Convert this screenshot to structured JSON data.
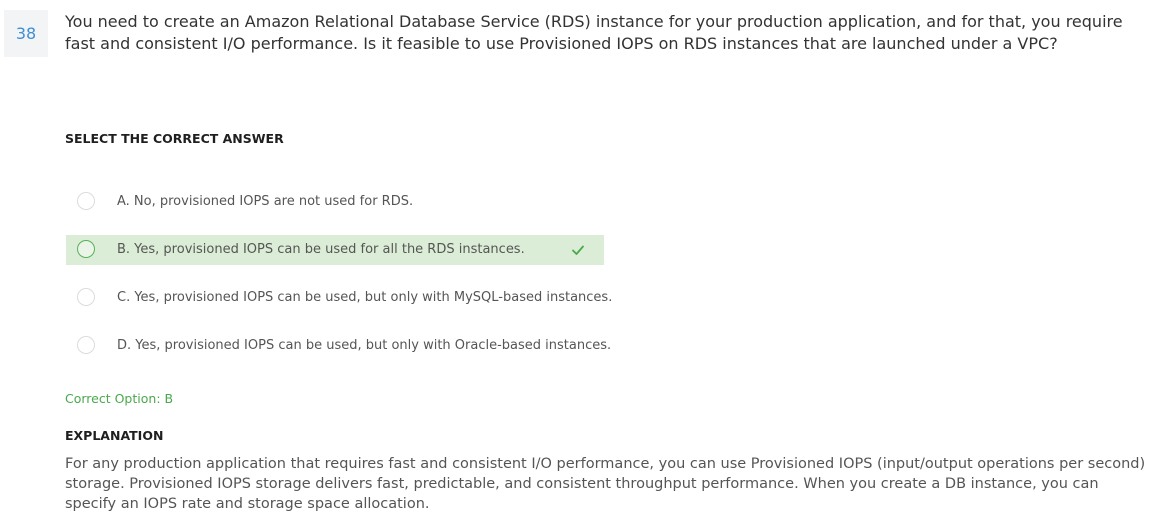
{
  "question": {
    "number": "38",
    "text": "You need to create an Amazon Relational Database Service (RDS) instance for your production application, and for that, you require fast and consistent I/O performance. Is it feasible to use Provisioned IOPS on RDS instances that are launched under a VPC?"
  },
  "answers": {
    "heading": "SELECT THE CORRECT ANSWER",
    "options": [
      {
        "label": "A. No, provisioned IOPS are not used for RDS.",
        "state": "unselected"
      },
      {
        "label": "B. Yes, provisioned IOPS can be used for all the RDS instances.",
        "state": "correct",
        "icon": "checkmark-icon"
      },
      {
        "label": "C. Yes, provisioned IOPS can be used, but only with MySQL-based instances.",
        "state": "unselected"
      },
      {
        "label": "D. Yes, provisioned IOPS can be used, but only with Oracle-based instances.",
        "state": "unselected"
      }
    ],
    "correct_option_text": "Correct Option: B"
  },
  "explanation": {
    "heading": "EXPLANATION",
    "text": "For any production application that requires fast and consistent I/O performance, you can use Provisioned IOPS (input/output operations per second) storage. Provisioned IOPS storage delivers fast, predictable, and consistent throughput performance. When you create a DB instance, you can specify an IOPS rate and storage space allocation."
  },
  "colors": {
    "accent_blue": "#3f8fd2",
    "correct_green": "#4aa84d",
    "correct_highlight": "#dbedd7"
  }
}
